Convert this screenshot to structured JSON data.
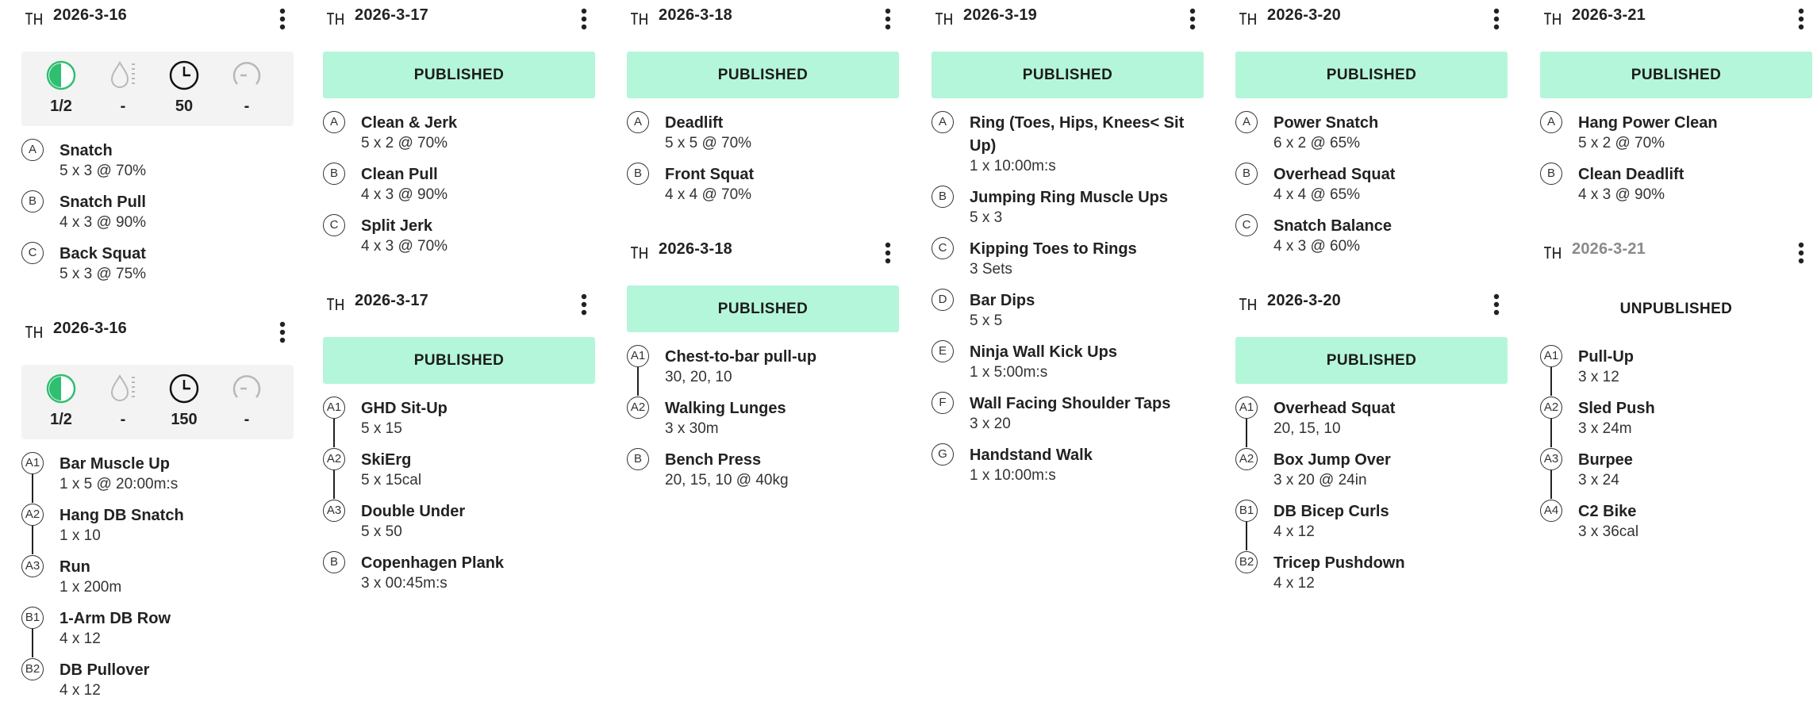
{
  "colors": {
    "published_bg": "#b4f6d9",
    "metric_panel_bg": "#f3f3f3",
    "progress_green": "#2fbf71",
    "text_primary": "#222222",
    "text_muted": "#8a8a8a"
  },
  "icons": {
    "template": "template-icon",
    "menu": "kebab-menu-icon",
    "completion": "half-circle-icon",
    "hydration": "water-drop-icon",
    "duration": "clock-icon",
    "intensity": "gauge-icon"
  },
  "columns": [
    {
      "cards": [
        {
          "date": "2026-3-16",
          "metrics": {
            "completion": "1/2",
            "hydration": "-",
            "duration": "50",
            "intensity": "-"
          },
          "exercises": [
            {
              "badge": "A",
              "name": "Snatch",
              "detail": "5 x 3 @ 70%"
            },
            {
              "badge": "B",
              "name": "Snatch Pull",
              "detail": "4 x 3 @ 90%"
            },
            {
              "badge": "C",
              "name": "Back Squat",
              "detail": "5 x 3 @ 75%"
            }
          ]
        },
        {
          "date": "2026-3-16",
          "metrics": {
            "completion": "1/2",
            "hydration": "-",
            "duration": "150",
            "intensity": "-"
          },
          "exercises": [
            {
              "badge": "A1",
              "name": "Bar Muscle Up",
              "detail": "1 x 5 @ 20:00m:s",
              "linked": true
            },
            {
              "badge": "A2",
              "name": "Hang DB Snatch",
              "detail": "1 x 10",
              "linked": true
            },
            {
              "badge": "A3",
              "name": "Run",
              "detail": "1 x 200m"
            },
            {
              "badge": "B1",
              "name": "1-Arm DB Row",
              "detail": "4 x 12",
              "linked": true
            },
            {
              "badge": "B2",
              "name": "DB Pullover",
              "detail": "4 x 12"
            }
          ]
        }
      ]
    },
    {
      "cards": [
        {
          "date": "2026-3-17",
          "status": "PUBLISHED",
          "exercises": [
            {
              "badge": "A",
              "name": "Clean & Jerk",
              "detail": "5 x 2 @ 70%"
            },
            {
              "badge": "B",
              "name": "Clean Pull",
              "detail": "4 x 3 @ 90%"
            },
            {
              "badge": "C",
              "name": "Split Jerk",
              "detail": "4 x 3 @ 70%"
            }
          ]
        },
        {
          "date": "2026-3-17",
          "status": "PUBLISHED",
          "exercises": [
            {
              "badge": "A1",
              "name": "GHD Sit-Up",
              "detail": "5 x 15",
              "linked": true
            },
            {
              "badge": "A2",
              "name": "SkiErg",
              "detail": "5 x 15cal",
              "linked": true
            },
            {
              "badge": "A3",
              "name": "Double Under",
              "detail": "5 x 50"
            },
            {
              "badge": "B",
              "name": "Copenhagen Plank",
              "detail": "3 x 00:45m:s"
            }
          ]
        }
      ]
    },
    {
      "cards": [
        {
          "date": "2026-3-18",
          "status": "PUBLISHED",
          "exercises": [
            {
              "badge": "A",
              "name": "Deadlift",
              "detail": "5 x 5 @ 70%"
            },
            {
              "badge": "B",
              "name": "Front Squat",
              "detail": "4 x 4 @ 70%"
            }
          ]
        },
        {
          "date": "2026-3-18",
          "status": "PUBLISHED",
          "exercises": [
            {
              "badge": "A1",
              "name": "Chest-to-bar pull-up",
              "detail": "30, 20, 10",
              "linked": true
            },
            {
              "badge": "A2",
              "name": "Walking Lunges",
              "detail": "3 x 30m"
            },
            {
              "badge": "B",
              "name": "Bench Press",
              "detail": "20, 15, 10 @ 40kg"
            }
          ]
        }
      ]
    },
    {
      "cards": [
        {
          "date": "2026-3-19",
          "status": "PUBLISHED",
          "exercises": [
            {
              "badge": "A",
              "name": "Ring (Toes, Hips, Knees< Sit Up)",
              "detail": "1 x 10:00m:s",
              "tall": true
            },
            {
              "badge": "B",
              "name": "Jumping Ring Muscle Ups",
              "detail": "5 x 3"
            },
            {
              "badge": "C",
              "name": "Kipping Toes to Rings",
              "detail": "3 Sets"
            },
            {
              "badge": "D",
              "name": "Bar Dips",
              "detail": "5 x 5"
            },
            {
              "badge": "E",
              "name": "Ninja Wall Kick Ups",
              "detail": "1 x 5:00m:s"
            },
            {
              "badge": "F",
              "name": "Wall Facing Shoulder Taps",
              "detail": "3 x 20"
            },
            {
              "badge": "G",
              "name": "Handstand Walk",
              "detail": "1 x 10:00m:s"
            }
          ]
        }
      ]
    },
    {
      "cards": [
        {
          "date": "2026-3-20",
          "status": "PUBLISHED",
          "exercises": [
            {
              "badge": "A",
              "name": "Power Snatch",
              "detail": "6 x 2 @ 65%"
            },
            {
              "badge": "B",
              "name": "Overhead Squat",
              "detail": "4 x 4 @ 65%"
            },
            {
              "badge": "C",
              "name": "Snatch Balance",
              "detail": "4 x 3 @ 60%"
            }
          ]
        },
        {
          "date": "2026-3-20",
          "status": "PUBLISHED",
          "exercises": [
            {
              "badge": "A1",
              "name": "Overhead Squat",
              "detail": "20, 15, 10",
              "linked": true
            },
            {
              "badge": "A2",
              "name": "Box Jump Over",
              "detail": "3 x 20 @ 24in"
            },
            {
              "badge": "B1",
              "name": "DB Bicep Curls",
              "detail": "4 x 12",
              "linked": true
            },
            {
              "badge": "B2",
              "name": "Tricep Pushdown",
              "detail": "4 x 12"
            }
          ]
        }
      ]
    },
    {
      "cards": [
        {
          "date": "2026-3-21",
          "status": "PUBLISHED",
          "exercises": [
            {
              "badge": "A",
              "name": "Hang Power Clean",
              "detail": "5 x 2 @ 70%"
            },
            {
              "badge": "B",
              "name": "Clean Deadlift",
              "detail": "4 x 3 @ 90%"
            }
          ]
        },
        {
          "date": "2026-3-21",
          "muted": true,
          "status": "UNPUBLISHED",
          "exercises": [
            {
              "badge": "A1",
              "name": "Pull-Up",
              "detail": "3 x 12",
              "linked": true
            },
            {
              "badge": "A2",
              "name": "Sled Push",
              "detail": "3 x 24m",
              "linked": true
            },
            {
              "badge": "A3",
              "name": "Burpee",
              "detail": "3 x 24",
              "linked": true
            },
            {
              "badge": "A4",
              "name": "C2 Bike",
              "detail": "3 x 36cal"
            }
          ]
        }
      ]
    }
  ]
}
